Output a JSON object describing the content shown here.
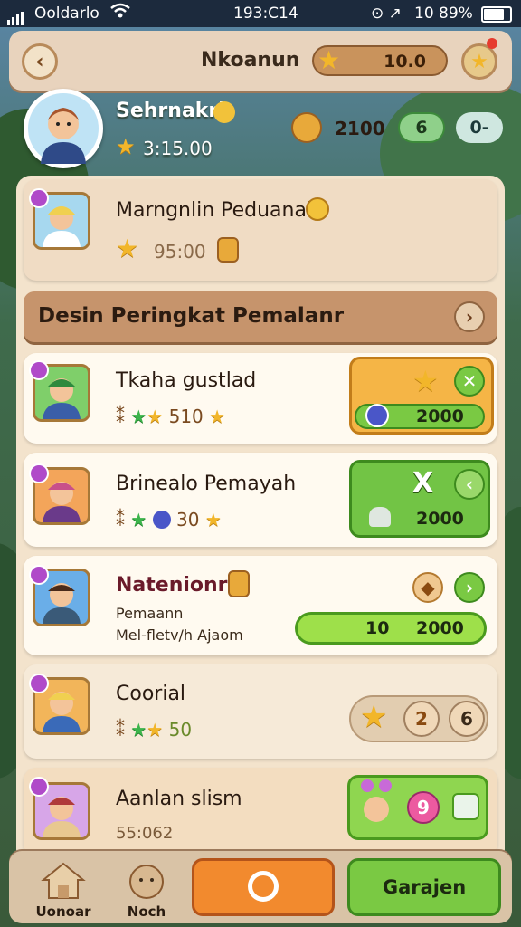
{
  "status_bar": {
    "carrier": "Ooldarlo",
    "time": "193:C14",
    "indicators": "10 89%"
  },
  "header": {
    "title": "Nkoanun",
    "coin_value": "10.0"
  },
  "profile": {
    "name": "Sehrnakri",
    "score": "3:15.00",
    "stat_value": "2100",
    "badge_value": "6",
    "extra": "0-"
  },
  "featured": {
    "name": "Marngnlin Peduanain",
    "score": "95:00"
  },
  "banner": {
    "title": "Desin Peringkat Pemalanr"
  },
  "rows": [
    {
      "name": "Tkaha gustlad",
      "rating": "510",
      "amount": "2000",
      "button_symbol": "✕"
    },
    {
      "name": "Brinealo Pemayah",
      "rating": "30",
      "amount": "2000",
      "button_symbol": "X"
    },
    {
      "name": "Natenionri",
      "sub1": "Pemaann",
      "sub2": "Mel-fletv/h Ajaom",
      "left_value": "10",
      "amount": "2000"
    },
    {
      "name": "Coorial",
      "rating": "50",
      "circle1": "2",
      "circle2": "6"
    },
    {
      "name": "Aanlan slism",
      "score": "55:062",
      "circle_value": "9"
    }
  ],
  "bottom_nav": {
    "home_label": "Uonoar",
    "second_label": "Noch",
    "action_label": "Garajen"
  },
  "colors": {
    "orange": "#f29a2e",
    "green": "#7ac943",
    "panel": "#f3e3cc"
  }
}
